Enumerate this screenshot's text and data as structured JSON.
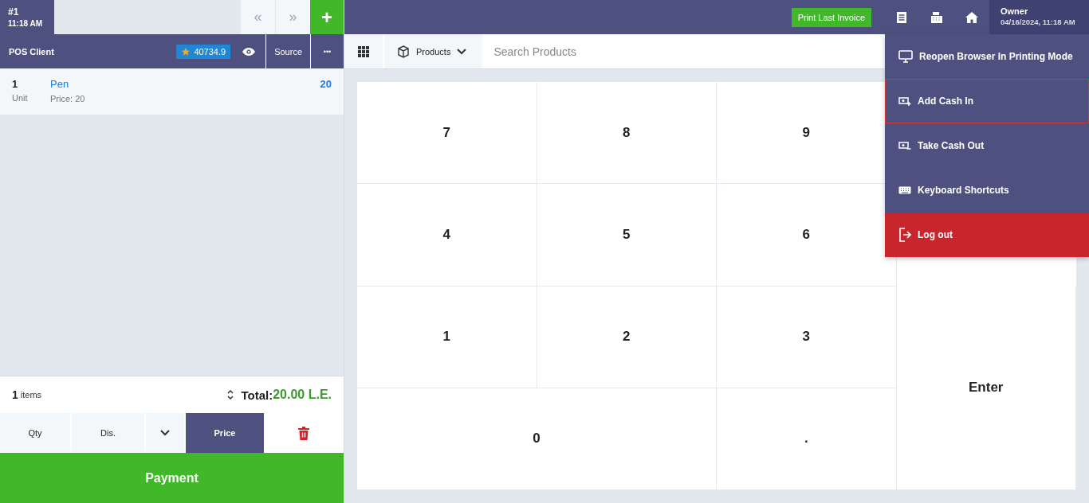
{
  "ticket": {
    "number": "#1",
    "time": "11:18 AM"
  },
  "nav": {
    "prev": {
      "label": "«",
      "disabled": true
    },
    "next": {
      "label": "»",
      "disabled": true
    },
    "add": "+"
  },
  "top_bar": {
    "print_button": "Print Last Invoice",
    "user": {
      "name": "Owner",
      "datetime": "04/16/2024, 11:18 AM"
    }
  },
  "client": {
    "name": "POS Client",
    "points": "40734.9",
    "source_button": "Source",
    "more_button": "•••"
  },
  "order_lines": [
    {
      "qty": "1",
      "unit": "Unit",
      "name": "Pen",
      "price": "Price: 20",
      "total": "20"
    }
  ],
  "summary": {
    "count": "1",
    "count_label": "items",
    "total_label": "Total:",
    "total": "20.00 L.E."
  },
  "modes": [
    {
      "label": "Qty",
      "kind": "text",
      "selected": false
    },
    {
      "label": "Dis.",
      "kind": "text",
      "selected": false
    },
    {
      "kind": "caret",
      "selected": false
    },
    {
      "label": "Price",
      "kind": "text",
      "selected": true
    },
    {
      "kind": "delete",
      "selected": false
    }
  ],
  "payment_button": "Payment",
  "search": {
    "category": "Products",
    "placeholder": "Search Products"
  },
  "keypad": [
    "7",
    "8",
    "9",
    "4",
    "5",
    "6",
    "1",
    "2",
    "3",
    "0",
    ".",
    "Enter"
  ],
  "menu": [
    {
      "label": "Reopen Browser In Printing Mode",
      "kind": "normal",
      "highlighted": false
    },
    {
      "label": "Add Cash In",
      "kind": "normal",
      "highlighted": true
    },
    {
      "label": "Take Cash Out",
      "kind": "normal",
      "highlighted": false
    },
    {
      "label": "Keyboard Shortcuts",
      "kind": "normal",
      "highlighted": false
    },
    {
      "label": "Log out",
      "kind": "danger",
      "highlighted": false
    }
  ]
}
